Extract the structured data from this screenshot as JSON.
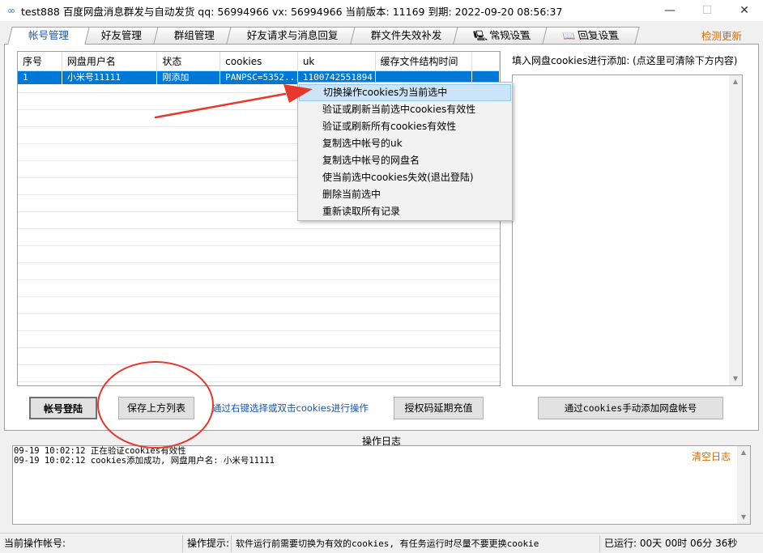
{
  "window": {
    "title": "test888  百度网盘消息群发与自动发货   qq: 56994966   vx: 56994966    当前版本: 11169  到期: 2022-09-20 08:56:37",
    "minimize_glyph": "—",
    "maximize_glyph": "☐",
    "close_glyph": "✕"
  },
  "tabs": [
    {
      "label": "帐号管理",
      "active": true
    },
    {
      "label": "好友管理"
    },
    {
      "label": "群组管理"
    },
    {
      "label": "好友请求与消息回复"
    },
    {
      "label": "群文件失效补发"
    },
    {
      "label": "常规设置",
      "icon": "computer-icon"
    },
    {
      "label": "回复设置",
      "icon": "book-icon"
    }
  ],
  "check_update": "检测更新",
  "grid": {
    "columns": [
      "序号",
      "网盘用户名",
      "状态",
      "cookies",
      "uk",
      "缓存文件结构时间"
    ],
    "rows": [
      [
        "1",
        "小米号11111",
        "刚添加",
        "PANPSC=5352...",
        "1100742551894",
        ""
      ]
    ]
  },
  "context_menu": [
    "切换操作cookies为当前选中",
    "验证或刷新当前选中cookies有效性",
    "验证或刷新所有cookies有效性",
    "复制选中帐号的uk",
    "复制选中帐号的网盘名",
    "使当前选中cookies失效(退出登陆)",
    "删除当前选中",
    "重新读取所有记录"
  ],
  "right_panel": {
    "label": "填入网盘cookies进行添加: (点这里可清除下方内容)"
  },
  "buttons": {
    "login": "帐号登陆",
    "save_list": "保存上方列表",
    "hint": "通过右键选择或双击cookies进行操作",
    "auth_code": "授权码延期充值",
    "manual_add": "通过cookies手动添加网盘帐号"
  },
  "log": {
    "title": "操作日志",
    "clear": "清空日志",
    "lines": [
      "09-19 10:02:12  正在验证cookies有效性",
      "09-19 10:02:12  cookies添加成功, 网盘用户名: 小米号11111"
    ]
  },
  "statusbar": {
    "current_account": "当前操作帐号:",
    "hint_label": "操作提示:",
    "hint_text": "软件运行前需要切换为有效的cookies, 有任务运行时尽量不要更换cookie",
    "runtime": "已运行: 00天 00时 06分 36秒"
  },
  "colors": {
    "selection": "#0078d7",
    "annotation": "#e8372c",
    "accent_orange": "#d46a00",
    "link_blue": "#1a56b0"
  }
}
